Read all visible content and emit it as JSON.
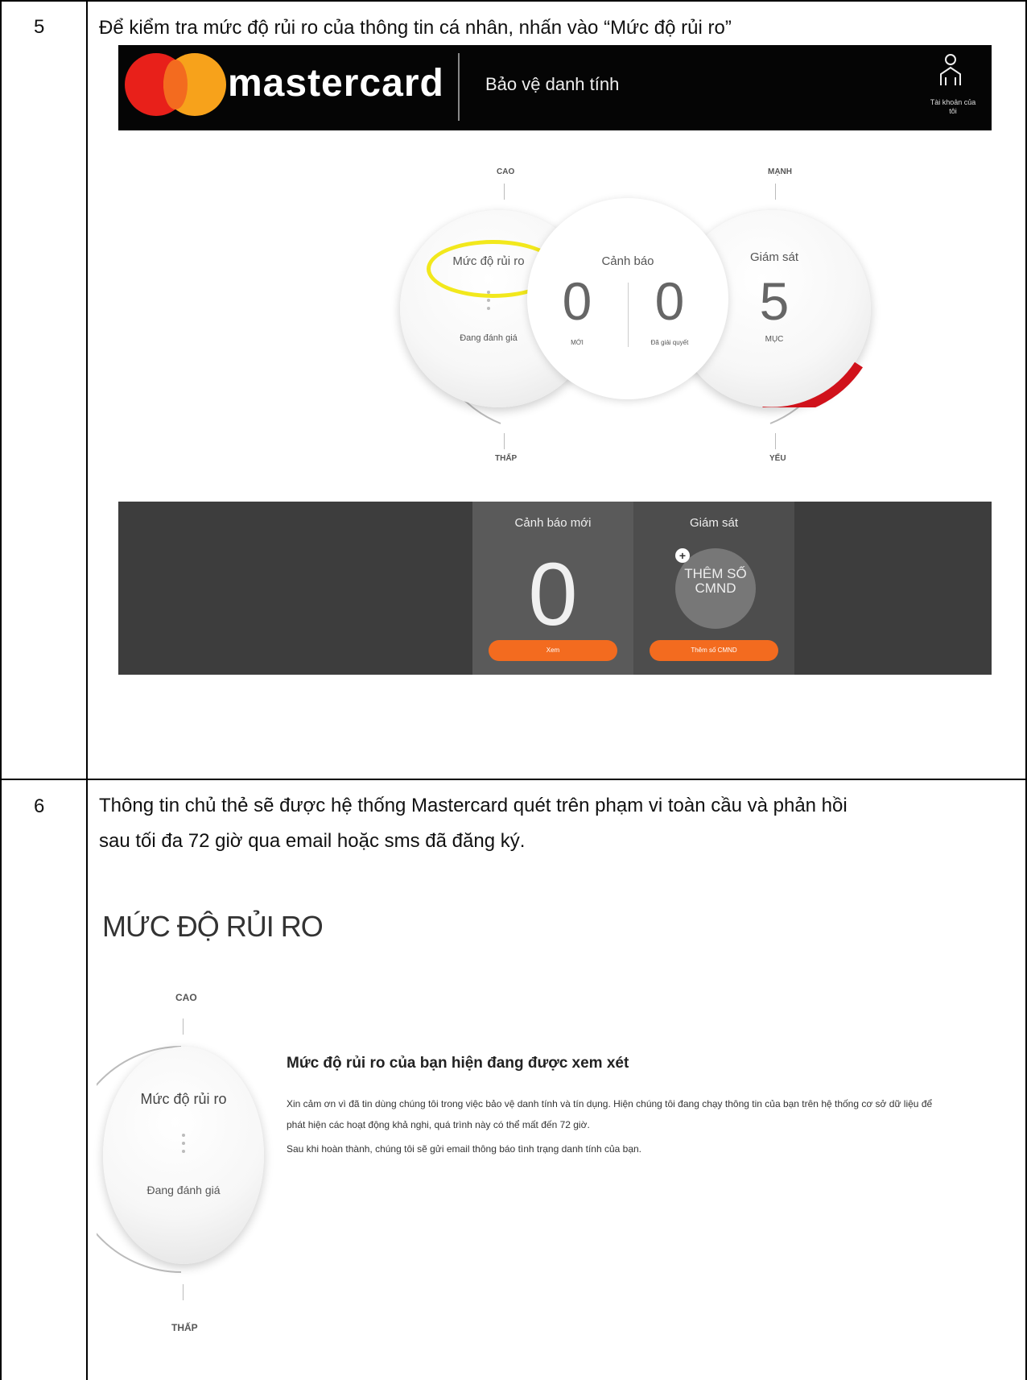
{
  "rows": [
    {
      "step": "5",
      "instruction": "Để kiểm tra mức độ rủi ro của thông tin cá nhân, nhấn vào “Mức độ rủi ro”"
    },
    {
      "step": "6",
      "instruction_line1": "Thông tin chủ thẻ sẽ được hệ thống Mastercard quét trên phạm vi toàn cầu và phản hồi",
      "instruction_line2": "sau tối đa 72 giờ qua email hoặc sms đã đăng ký."
    }
  ],
  "shot1": {
    "brand": "mastercard",
    "header_subtitle": "Bảo vệ danh tính",
    "account_label": "Tài khoản của tôi",
    "scale_high_left": "CAO",
    "scale_low_left": "THẤP",
    "scale_high_right": "MẠNH",
    "scale_low_right": "YẾU",
    "risk_circle": {
      "title": "Mức độ rủi ro",
      "status": "Đang đánh giá"
    },
    "alert_circle": {
      "title": "Cảnh báo",
      "new_count": "0",
      "new_label": "MỚI",
      "resolved_count": "0",
      "resolved_label": "Đã giải quyết"
    },
    "monitor_circle": {
      "title": "Giám sát",
      "count": "5",
      "unit": "MỤC",
      "progress_fraction": 0.2
    },
    "panel_alerts": {
      "title": "Cảnh báo mới",
      "count": "0",
      "button": "Xem"
    },
    "panel_monitor": {
      "title": "Giám sát",
      "add_text_line1": "THÊM SỐ",
      "add_text_line2": "CMND",
      "button": "Thêm số CMND"
    },
    "colors": {
      "header_bg": "#050505",
      "accent_orange": "#f36b1f",
      "highlight_yellow": "#f2e81c",
      "progress_red": "#d0121b"
    }
  },
  "shot2": {
    "title": "MỨC ĐỘ RỦI RO",
    "scale_high": "CAO",
    "scale_low": "THẤP",
    "circle_title": "Mức độ rủi ro",
    "circle_status": "Đang đánh giá",
    "heading": "Mức độ rủi ro của bạn hiện đang được xem xét",
    "para1_line1": "Xin cảm ơn vì đã tin dùng chúng tôi trong việc bảo vệ danh tính và tín dụng. Hiện chúng tôi đang chạy thông tin của bạn trên hệ thống cơ sở dữ liệu để",
    "para1_line2": "phát hiện các hoạt động khả nghi, quá trình này có thể mất đến 72 giờ.",
    "para2": "Sau khi hoàn thành, chúng tôi sẽ gửi email thông báo tình trạng danh tính của bạn."
  }
}
